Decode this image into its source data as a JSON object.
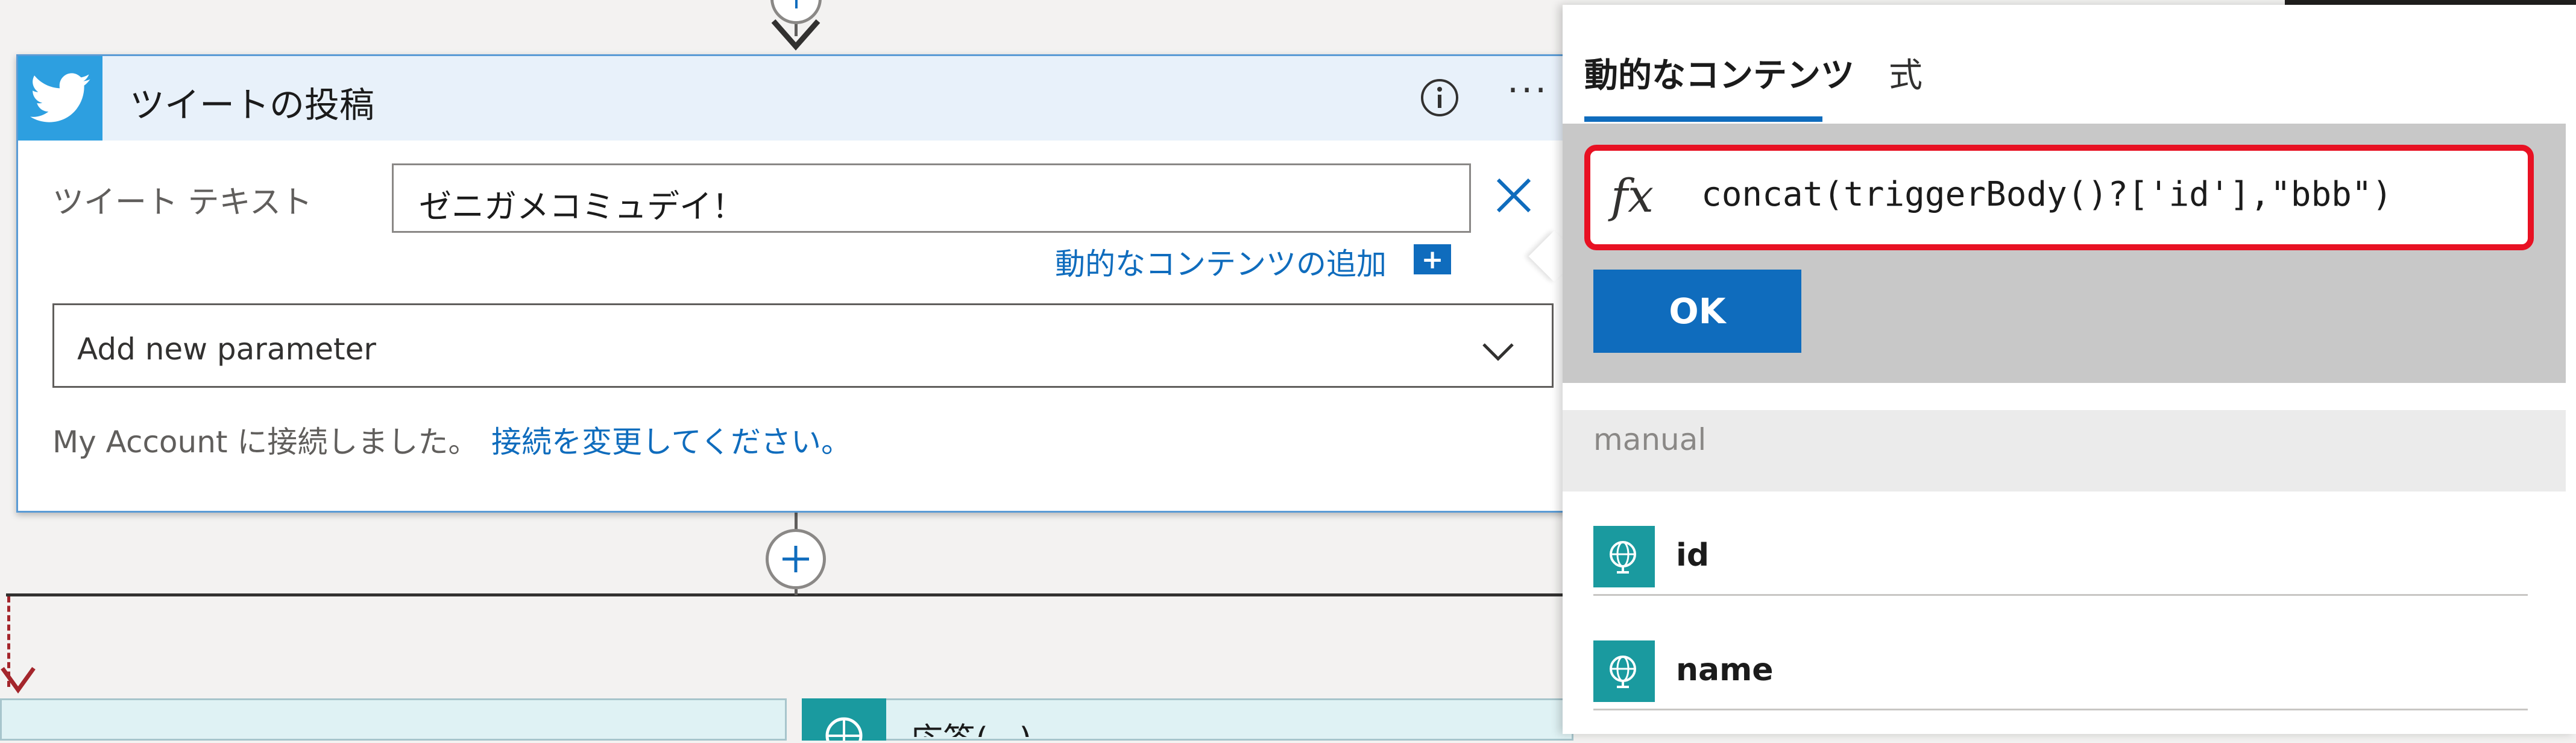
{
  "tweet_card": {
    "title": "ツイートの投稿",
    "more_label": "···",
    "tweet_text_label": "ツイート テキスト",
    "tweet_text_value": "ゼニガメコミュデイ！",
    "add_dynamic_content_link": "動的なコンテンツの追加",
    "add_new_parameter": "Add new parameter",
    "connection_text": "My Account に接続しました。",
    "change_connection_link": "接続を変更してください。"
  },
  "lower_card": {
    "title": "応答(...)"
  },
  "dynamic_panel": {
    "tabs": [
      {
        "label": "動的なコンテンツ",
        "active": true
      },
      {
        "label": "式",
        "active": false
      }
    ],
    "fx_symbol": "fx",
    "expression": "concat(triggerBody()?['id'],\"bbb\")",
    "ok_label": "OK",
    "section_title": "manual",
    "items": [
      {
        "label": "id",
        "icon": "globe-icon"
      },
      {
        "label": "name",
        "icon": "globe-icon"
      }
    ]
  },
  "colors": {
    "accent": "#0f6cbd",
    "twitter": "#2d9fe0",
    "highlight_border": "#e81123",
    "trigger_teal": "#1a9a9f"
  }
}
